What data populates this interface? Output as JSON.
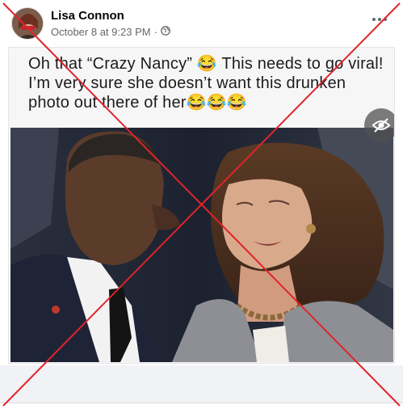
{
  "post": {
    "author": "Lisa Connon",
    "timestamp": "October 8 at 9:23 PM",
    "separator": "·",
    "audience_icon": "globe-icon",
    "more_icon": "more-options-icon"
  },
  "image": {
    "caption": "Oh that “Crazy Nancy” 😂 This needs to go viral! I’m very sure she doesn’t want this drunken photo out there of her😂😂😂",
    "sensitive_icon": "eye-slash-icon"
  },
  "overlay": {
    "color": "#e0242b",
    "icon": "red-x-mark"
  }
}
